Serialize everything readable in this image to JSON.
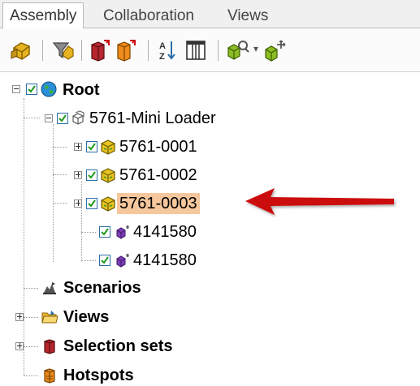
{
  "tabs": [
    {
      "label": "Assembly"
    },
    {
      "label": "Collaboration"
    },
    {
      "label": "Views"
    }
  ],
  "toolbar": {
    "icons": [
      "group-icon",
      "filter-icon",
      "expand-red-icon",
      "expand-orange-icon",
      "sort-az-icon",
      "columns-icon",
      "find-icon",
      "move-icon"
    ]
  },
  "tree": {
    "root": "Root",
    "assembly": "5761-Mini Loader",
    "parts": [
      "5761-0001",
      "5761-0002",
      "5761-0003",
      "4141580",
      "4141580"
    ],
    "scenarios": "Scenarios",
    "views": "Views",
    "selection_sets": "Selection sets",
    "hotspots": "Hotspots"
  },
  "colors": {
    "selection": "#f6c79c",
    "arrow": "#cc1111",
    "checkbox_border": "#2a6ea8",
    "check": "#1f9a1f"
  }
}
